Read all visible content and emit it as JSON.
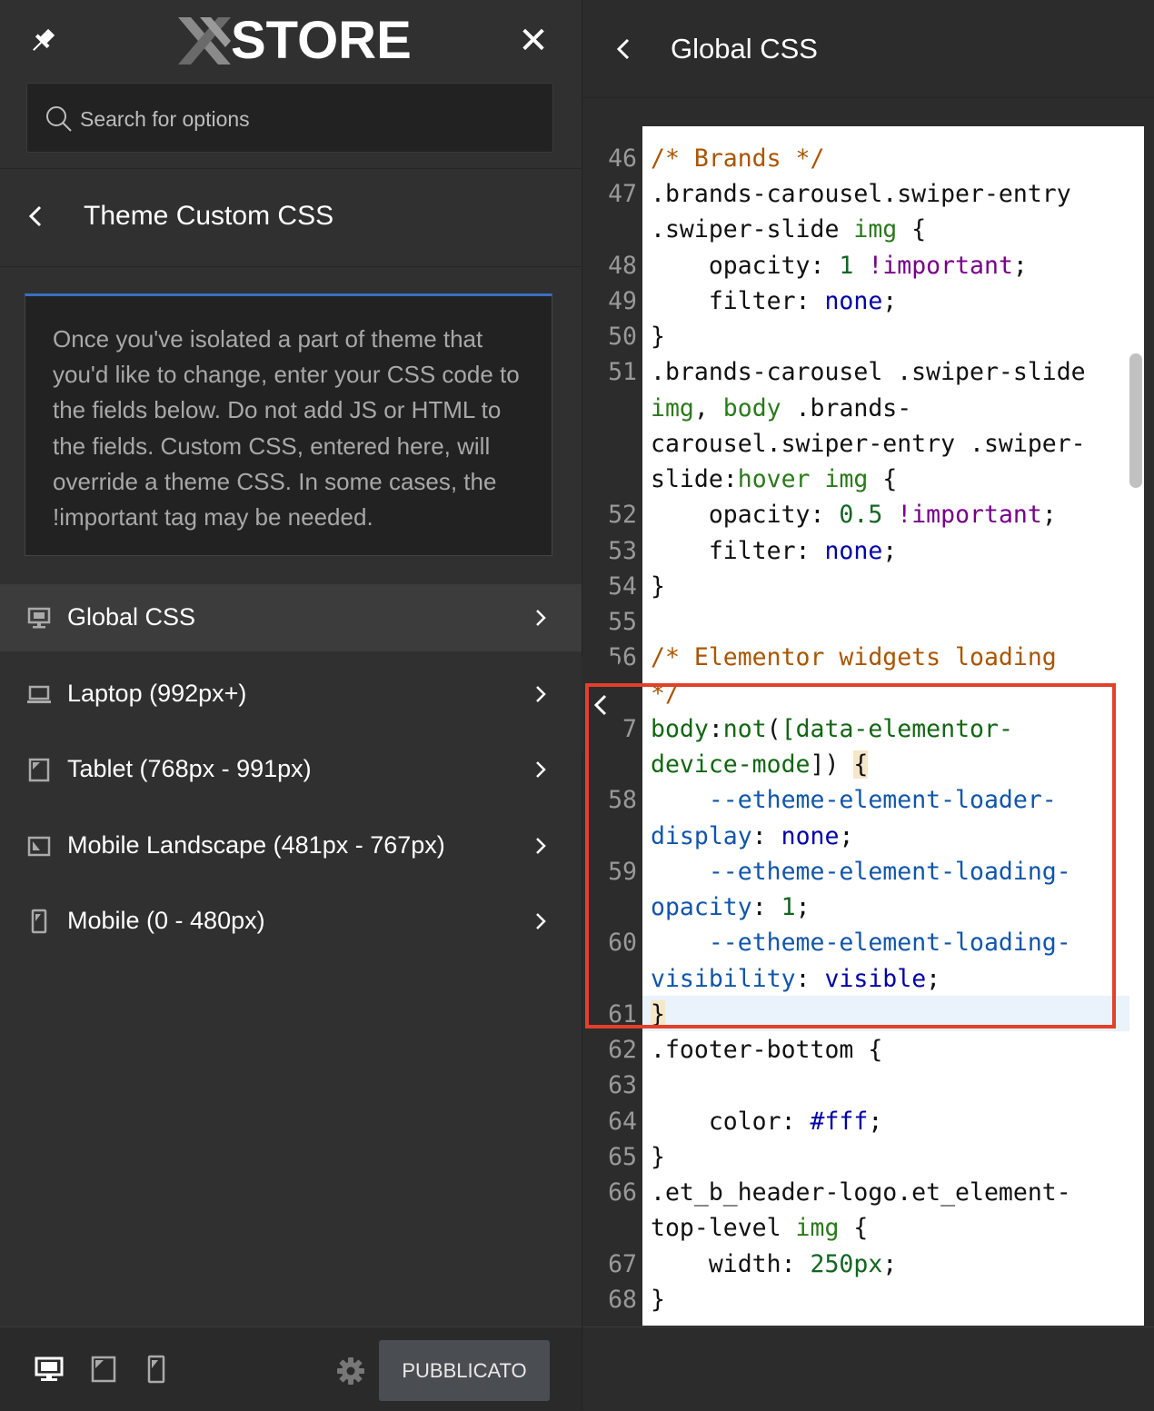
{
  "header": {
    "logo_text": "STORE",
    "search_placeholder": "Search for options"
  },
  "section": {
    "title": "Theme Custom CSS"
  },
  "info_text": "Once you've isolated a part of theme that you'd like to change, enter your CSS code to the fields below. Do not add JS or HTML to the fields. Custom CSS, entered here, will override a theme CSS. In some cases, the !important tag may be needed.",
  "menu": [
    {
      "label": "Global CSS",
      "icon": "desktop-icon",
      "active": true
    },
    {
      "label": "Laptop (992px+)",
      "icon": "laptop-icon"
    },
    {
      "label": "Tablet (768px - 991px)",
      "icon": "tablet-icon"
    },
    {
      "label": "Mobile Landscape (481px - 767px)",
      "icon": "mobile-landscape-icon"
    },
    {
      "label": "Mobile (0 - 480px)",
      "icon": "mobile-icon"
    }
  ],
  "footer": {
    "publish_label": "PUBBLICATO"
  },
  "editor": {
    "title": "Global CSS",
    "line_numbers": [
      "46",
      "47",
      "48",
      "49",
      "50",
      "51",
      "52",
      "53",
      "54",
      "55",
      "56",
      "7",
      "58",
      "59",
      "60",
      "61",
      "62",
      "63",
      "64",
      "65",
      "66",
      "67",
      "68"
    ]
  },
  "colors": {
    "highlight_border": "#e2402b",
    "accent": "#3a6fc4"
  }
}
